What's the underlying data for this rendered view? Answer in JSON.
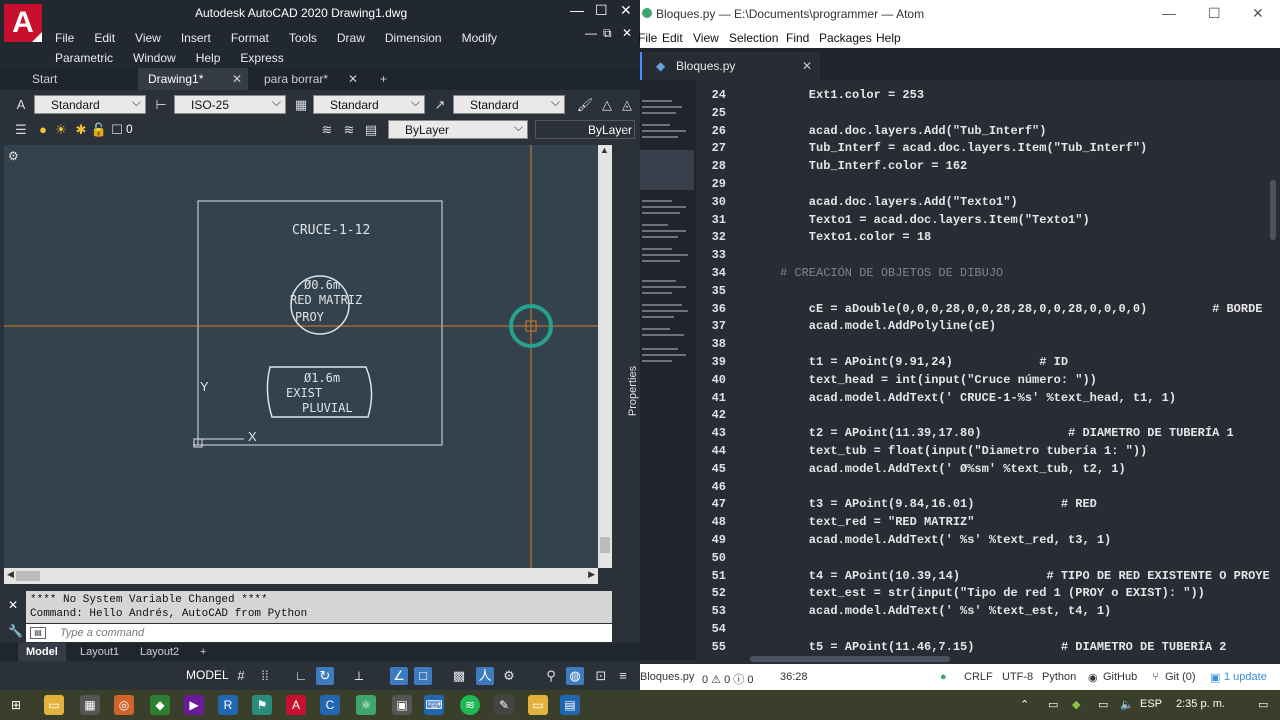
{
  "autocad": {
    "title": "Autodesk AutoCAD 2020   Drawing1.dwg",
    "logo": "A",
    "menu": [
      "File",
      "Edit",
      "View",
      "Insert",
      "Format",
      "Tools",
      "Draw",
      "Dimension",
      "Modify",
      "Parametric",
      "Window",
      "Help",
      "Express"
    ],
    "tabs": [
      {
        "label": "Start"
      },
      {
        "label": "Drawing1*"
      },
      {
        "label": "para borrar*"
      }
    ],
    "toolbar1": {
      "text_style": "Standard",
      "dim_style": "ISO-25",
      "table_style": "Standard",
      "multileader_style": "Standard"
    },
    "toolbar2": {
      "layer": "0",
      "color": "ByLayer",
      "linetype": "ByLayer"
    },
    "drawing": {
      "title_text": "CRUCE-1-12",
      "circle_text_1": "Ø0.6m",
      "circle_text_2": "RED MATRIZ",
      "circle_text_3": "PROY",
      "box_text_1": "Ø1.6m",
      "box_text_2": "EXIST",
      "box_text_3": "PLUVIAL",
      "ucs_y": "Y",
      "ucs_x": "X"
    },
    "properties_label": "Properties",
    "command_history": [
      "**** No System Variable Changed ****",
      "Command: Hello Andrés, AutoCAD from Python"
    ],
    "command_placeholder": "Type a command",
    "layout_tabs": [
      "Model",
      "Layout1",
      "Layout2"
    ],
    "status_model": "MODEL"
  },
  "atom": {
    "title": "Bloques.py — E:\\Documents\\programmer — Atom",
    "menu": [
      "File",
      "Edit",
      "View",
      "Selection",
      "Find",
      "Packages",
      "Help"
    ],
    "tab": "Bloques.py",
    "lines": [
      {
        "n": "24",
        "code": "    Ext1.color = 253"
      },
      {
        "n": "25",
        "code": ""
      },
      {
        "n": "26",
        "code": "    acad.doc.layers.Add(\"Tub_Interf\")"
      },
      {
        "n": "27",
        "code": "    Tub_Interf = acad.doc.layers.Item(\"Tub_Interf\")"
      },
      {
        "n": "28",
        "code": "    Tub_Interf.color = 162"
      },
      {
        "n": "29",
        "code": ""
      },
      {
        "n": "30",
        "code": "    acad.doc.layers.Add(\"Texto1\")"
      },
      {
        "n": "31",
        "code": "    Texto1 = acad.doc.layers.Item(\"Texto1\")"
      },
      {
        "n": "32",
        "code": "    Texto1.color = 18"
      },
      {
        "n": "33",
        "code": ""
      },
      {
        "n": "34",
        "code": "# CREACIÓN DE OBJETOS DE DIBUJO"
      },
      {
        "n": "35",
        "code": ""
      },
      {
        "n": "36",
        "code": "    cE = aDouble(0,0,0,28,0,0,28,28,0,0,28,0,0,0,0)         # BORDE"
      },
      {
        "n": "37",
        "code": "    acad.model.AddPolyline(cE)"
      },
      {
        "n": "38",
        "code": ""
      },
      {
        "n": "39",
        "code": "    t1 = APoint(9.91,24)            # ID"
      },
      {
        "n": "40",
        "code": "    text_head = int(input(\"Cruce número: \"))"
      },
      {
        "n": "41",
        "code": "    acad.model.AddText(' CRUCE-1-%s' %text_head, t1, 1)"
      },
      {
        "n": "42",
        "code": ""
      },
      {
        "n": "43",
        "code": "    t2 = APoint(11.39,17.80)            # DIAMETRO DE TUBERÍA 1"
      },
      {
        "n": "44",
        "code": "    text_tub = float(input(\"Diametro tubería 1: \"))"
      },
      {
        "n": "45",
        "code": "    acad.model.AddText(' Ø%sm' %text_tub, t2, 1)"
      },
      {
        "n": "46",
        "code": ""
      },
      {
        "n": "47",
        "code": "    t3 = APoint(9.84,16.01)            # RED"
      },
      {
        "n": "48",
        "code": "    text_red = \"RED MATRIZ\""
      },
      {
        "n": "49",
        "code": "    acad.model.AddText(' %s' %text_red, t3, 1)"
      },
      {
        "n": "50",
        "code": ""
      },
      {
        "n": "51",
        "code": "    t4 = APoint(10.39,14)            # TIPO DE RED EXISTENTE O PROYE"
      },
      {
        "n": "52",
        "code": "    text_est = str(input(\"Tipo de red 1 (PROY o EXIST): \"))"
      },
      {
        "n": "53",
        "code": "    acad.model.AddText(' %s' %text_est, t4, 1)"
      },
      {
        "n": "54",
        "code": ""
      },
      {
        "n": "55",
        "code": "    t5 = APoint(11.46,7.15)            # DIAMETRO DE TUBERÍA 2"
      }
    ],
    "status": {
      "file": "Bloques.py",
      "diagnostics": "0 ⚠ 0 ⓘ 0",
      "cursor": "36:28",
      "line_ending": "CRLF",
      "encoding": "UTF-8",
      "grammar": "Python",
      "github": "GitHub",
      "git": "Git (0)",
      "updates": "1 update"
    }
  },
  "taskbar": {
    "lang": "ESP",
    "time": "2:35 p. m."
  },
  "colors": {
    "autocad_canvas": "#33424c",
    "crosshair": "#d87c2a",
    "atom_bg": "#282c34",
    "accent_blue": "#528bff",
    "autocad_red": "#c8102e"
  }
}
